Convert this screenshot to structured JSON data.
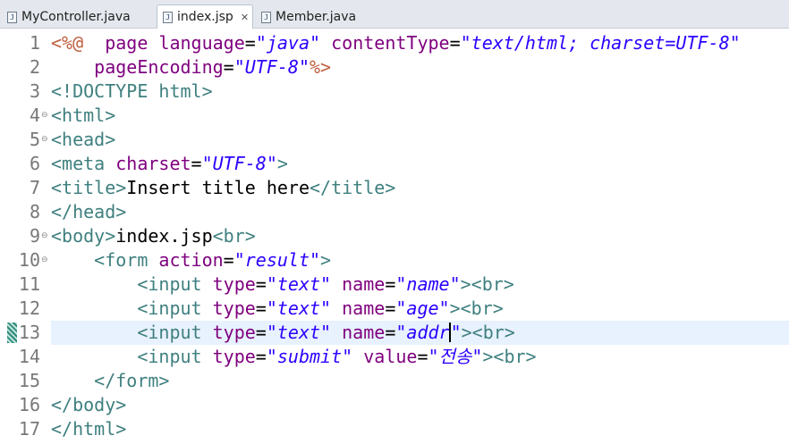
{
  "tabs": [
    {
      "label": "MyController.java",
      "active": false
    },
    {
      "label": "index.jsp",
      "active": true,
      "close": "✕"
    },
    {
      "label": "Member.java",
      "active": false
    }
  ],
  "lines": [
    {
      "n": "1",
      "fold": false,
      "tokens": [
        [
          "d",
          "<%@"
        ],
        [
          "",
          "  "
        ],
        [
          "a",
          "page"
        ],
        [
          "",
          " "
        ],
        [
          "a",
          "language"
        ],
        [
          "",
          "="
        ],
        [
          "v",
          "\"java\""
        ],
        [
          "",
          " "
        ],
        [
          "a",
          "contentType"
        ],
        [
          "",
          "="
        ],
        [
          "v",
          "\"text/html; charset=UTF-8\""
        ]
      ]
    },
    {
      "n": "2",
      "fold": false,
      "tokens": [
        [
          "",
          "    "
        ],
        [
          "a",
          "pageEncoding"
        ],
        [
          "",
          "="
        ],
        [
          "v",
          "\"UTF-8\""
        ],
        [
          "d",
          "%>"
        ]
      ]
    },
    {
      "n": "3",
      "fold": false,
      "tokens": [
        [
          "t",
          "<!DOCTYPE html>"
        ]
      ]
    },
    {
      "n": "4",
      "fold": true,
      "tokens": [
        [
          "t",
          "<html>"
        ]
      ]
    },
    {
      "n": "5",
      "fold": true,
      "tokens": [
        [
          "t",
          "<head>"
        ]
      ]
    },
    {
      "n": "6",
      "fold": false,
      "tokens": [
        [
          "t",
          "<meta "
        ],
        [
          "a",
          "charset"
        ],
        [
          "",
          "="
        ],
        [
          "v",
          "\"UTF-8\""
        ],
        [
          "t",
          ">"
        ]
      ]
    },
    {
      "n": "7",
      "fold": false,
      "tokens": [
        [
          "t",
          "<title>"
        ],
        [
          "",
          "Insert title here"
        ],
        [
          "t",
          "</title>"
        ]
      ]
    },
    {
      "n": "8",
      "fold": false,
      "tokens": [
        [
          "t",
          "</head>"
        ]
      ]
    },
    {
      "n": "9",
      "fold": true,
      "tokens": [
        [
          "t",
          "<body>"
        ],
        [
          "",
          "index.jsp"
        ],
        [
          "t",
          "<br>"
        ]
      ]
    },
    {
      "n": "10",
      "fold": true,
      "tokens": [
        [
          "",
          "    "
        ],
        [
          "t",
          "<form "
        ],
        [
          "a",
          "action"
        ],
        [
          "",
          "="
        ],
        [
          "v",
          "\"result\""
        ],
        [
          "t",
          ">"
        ]
      ]
    },
    {
      "n": "11",
      "fold": false,
      "tokens": [
        [
          "",
          "        "
        ],
        [
          "t",
          "<input "
        ],
        [
          "a",
          "type"
        ],
        [
          "",
          "="
        ],
        [
          "v",
          "\"text\""
        ],
        [
          "",
          " "
        ],
        [
          "a",
          "name"
        ],
        [
          "",
          "="
        ],
        [
          "v",
          "\"name\""
        ],
        [
          "t",
          "><br>"
        ]
      ]
    },
    {
      "n": "12",
      "fold": false,
      "tokens": [
        [
          "",
          "        "
        ],
        [
          "t",
          "<input "
        ],
        [
          "a",
          "type"
        ],
        [
          "",
          "="
        ],
        [
          "v",
          "\"text\""
        ],
        [
          "",
          " "
        ],
        [
          "a",
          "name"
        ],
        [
          "",
          "="
        ],
        [
          "v",
          "\"age\""
        ],
        [
          "t",
          "><br>"
        ]
      ]
    },
    {
      "n": "13",
      "fold": false,
      "current": true,
      "marker": true,
      "tokens": [
        [
          "",
          "        "
        ],
        [
          "t",
          "<input "
        ],
        [
          "a",
          "type"
        ],
        [
          "",
          "="
        ],
        [
          "v",
          "\"text\""
        ],
        [
          "",
          " "
        ],
        [
          "a",
          "name"
        ],
        [
          "",
          "="
        ],
        [
          "v",
          "\"addr"
        ],
        [
          "caret",
          ""
        ],
        [
          "v",
          "\""
        ],
        [
          "t",
          "><br>"
        ]
      ]
    },
    {
      "n": "14",
      "fold": false,
      "tokens": [
        [
          "",
          "        "
        ],
        [
          "t",
          "<input "
        ],
        [
          "a",
          "type"
        ],
        [
          "",
          "="
        ],
        [
          "v",
          "\"submit\""
        ],
        [
          "",
          " "
        ],
        [
          "a",
          "value"
        ],
        [
          "",
          "="
        ],
        [
          "v",
          "\"전송\""
        ],
        [
          "t",
          "><br>"
        ]
      ]
    },
    {
      "n": "15",
      "fold": false,
      "tokens": [
        [
          "",
          "    "
        ],
        [
          "t",
          "</form>"
        ]
      ]
    },
    {
      "n": "16",
      "fold": false,
      "tokens": [
        [
          "t",
          "</body>"
        ]
      ]
    },
    {
      "n": "17",
      "fold": false,
      "tokens": [
        [
          "t",
          "</html>"
        ]
      ]
    }
  ]
}
